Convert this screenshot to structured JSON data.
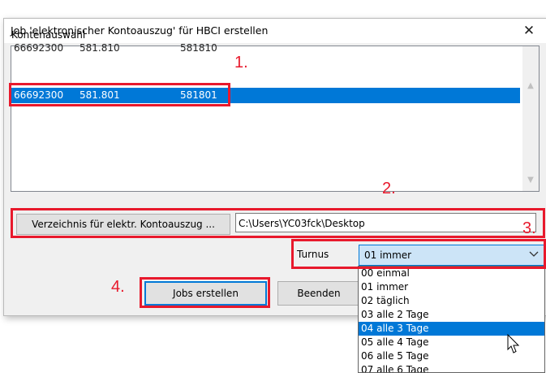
{
  "window": {
    "title": "Job 'elektronischer Kontoauszug' für HBCI erstellen",
    "close_glyph": "✕"
  },
  "accounts": {
    "label": "Kontenauswahl",
    "rows": [
      {
        "blz": "66692300",
        "acct_fmt": "581.810",
        "acct": "581810"
      },
      {
        "blz": "66692300",
        "acct_fmt": "581.801",
        "acct": "581801"
      }
    ],
    "selected_index": 1
  },
  "directory": {
    "button_label": "Verzeichnis für elektr. Kontoauszug ...",
    "path_value": "C:\\Users\\YC03fck\\Desktop"
  },
  "turnus": {
    "label": "Turnus",
    "selected": "01 immer",
    "options": [
      "00 einmal",
      "01 immer",
      "02 täglich",
      "03 alle 2 Tage",
      "04 alle 3 Tage",
      "05 alle 4 Tage",
      "06 alle 5 Tage",
      "07 alle 6 Tage"
    ],
    "highlighted_index": 4
  },
  "buttons": {
    "create": "Jobs erstellen",
    "exit": "Beenden"
  },
  "annotations": {
    "n1": "1.",
    "n2": "2.",
    "n3": "3.",
    "n4": "4."
  },
  "icons": {
    "close": "close-icon",
    "scroll_up": "chevron-up-icon",
    "scroll_down": "chevron-down-icon",
    "dropdown": "chevron-down-icon",
    "cursor": "mouse-pointer-icon"
  },
  "colors": {
    "selection": "#0078d7",
    "annotation_red": "#e8192c",
    "combo_bg": "#cce4f7"
  }
}
